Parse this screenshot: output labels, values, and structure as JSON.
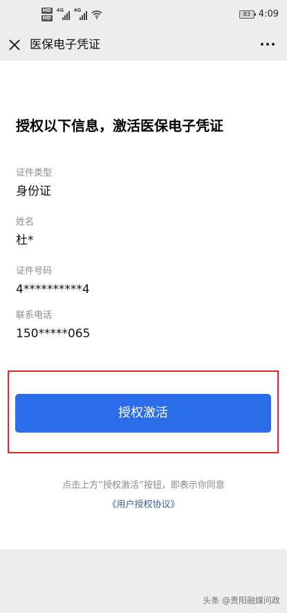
{
  "status_bar": {
    "hd_top": "HD",
    "hd_bottom": "HD",
    "net1": "4G",
    "net2": "4G",
    "battery": "83",
    "time": "4:09"
  },
  "nav": {
    "title": "医保电子凭证",
    "close_icon": "close-icon",
    "more_icon": "more-icon"
  },
  "main": {
    "heading": "授权以下信息，激活医保电子凭证",
    "fields": [
      {
        "label": "证件类型",
        "value": "身份证"
      },
      {
        "label": "姓名",
        "value": "杜*"
      },
      {
        "label": "证件号码",
        "value": "4**********4"
      },
      {
        "label": "联系电话",
        "value": "150*****065"
      }
    ],
    "activate_button": "授权激活",
    "note": "点击上方“授权激活”按钮，即表示你同意",
    "agreement_link": "《用户授权协议》"
  },
  "watermark": "头条 @贵阳融媒问政",
  "colors": {
    "primary": "#2b6de8",
    "highlight_border": "#e0242a",
    "link": "#3a5f94"
  }
}
